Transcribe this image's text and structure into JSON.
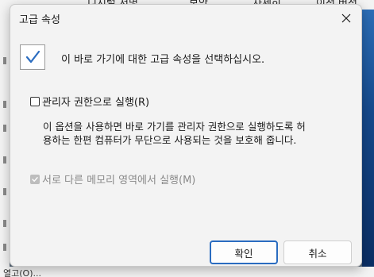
{
  "parent_window": {
    "tabs": [
      "디지털 서명",
      "보안",
      "자세히",
      "이전 버전"
    ],
    "bottom_text": "열고(O)..."
  },
  "dialog": {
    "title": "고급 속성",
    "header_text": "이 바로 가기에 대한 고급 속성을 선택하십시오.",
    "run_as_admin": {
      "label": "관리자 권한으로 실행(R)",
      "checked": false
    },
    "description_lines": [
      "이 옵션을 사용하면 바로 가기를 관리자 권한으로 실행하도록 허",
      "용하는 한편 컴퓨터가 무단으로 사용되는 것을 보호해 줍니다."
    ],
    "separate_memory": {
      "label": "서로 다른 메모리 영역에서 실행(M)",
      "checked": true,
      "enabled": false
    },
    "buttons": {
      "ok": "확인",
      "cancel": "취소"
    }
  },
  "icons": {
    "close": "close-icon",
    "shortcut": "checkmark-icon"
  },
  "colors": {
    "accent": "#2a6cc0",
    "dialog_bg": "#f3f3f3",
    "disabled_text": "#8a8a8a"
  }
}
